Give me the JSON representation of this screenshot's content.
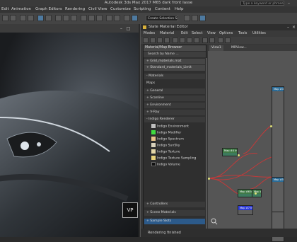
{
  "app": {
    "title": "Autodesk 3ds Max 2017     M65 dark front Iasse",
    "search_placeholder": "Type a keyword or phrase"
  },
  "menu": [
    "Edit",
    "Animation",
    "Graph Editors",
    "Rendering",
    "Civil View",
    "Customize",
    "Scripting",
    "Content",
    "Help"
  ],
  "toolbar": {
    "selection_sets": "Create Selection Se..."
  },
  "viewport": {
    "plate_text": "VP"
  },
  "slate": {
    "title": "Slate Material Editor",
    "menu": [
      "Modes",
      "Material",
      "Edit",
      "Select",
      "View",
      "Options",
      "Tools",
      "Utilities"
    ],
    "tabs": [
      "View1",
      "MRView..."
    ],
    "status": "Rendering finished"
  },
  "browser": {
    "title": "Material/Map Browser",
    "search": "Search by Name ...",
    "rows": [
      {
        "label": "+ Grid_materials.mat",
        "kind": "sub"
      },
      {
        "label": "+ Standard_materials_Limit",
        "kind": "sub"
      },
      {
        "label": "- Materials",
        "kind": "head"
      },
      {
        "label": "Maps",
        "kind": "head"
      },
      {
        "label": "+ General",
        "kind": "head"
      },
      {
        "label": "+ Scanline",
        "kind": "head"
      },
      {
        "label": "+ Environment",
        "kind": "head"
      },
      {
        "label": "+ V-Ray",
        "kind": "head"
      },
      {
        "label": "- Indigo Renderer",
        "kind": "head"
      }
    ],
    "indigo_items": [
      {
        "label": "Indigo Environment",
        "color": "#bfbfbf"
      },
      {
        "label": "Indigo Modifier",
        "color": "#3fdc3f"
      },
      {
        "label": "Indigo Spectrum",
        "color": "#e6c28a"
      },
      {
        "label": "Indigo SunSky",
        "color": "#d9d2bc"
      },
      {
        "label": "Indigo Texture",
        "color": "#e4d7a8"
      },
      {
        "label": "Indigo Texture Sampling",
        "color": "#e8d27a"
      },
      {
        "label": "Indigo Volume",
        "color": "#111111"
      }
    ],
    "bottom_rows": [
      {
        "label": "+ Controllers",
        "kind": "head"
      },
      {
        "label": "+ Scene Materials",
        "kind": "head"
      },
      {
        "label": "+ Sample Slots",
        "kind": "sel"
      }
    ]
  },
  "nodes": [
    {
      "label": "Map #3 Indigo Te...",
      "kind": "blue"
    },
    {
      "label": "Map #4 Indigo...",
      "kind": "green"
    },
    {
      "label": "Map #5 Indigo Ma...",
      "kind": "blue"
    },
    {
      "label": "Map #6 Indigo Ten...",
      "kind": "green"
    },
    {
      "label": "Map #7 Indigo Te...",
      "kind": "blue"
    },
    {
      "label": "Map #8",
      "kind": "green"
    }
  ]
}
